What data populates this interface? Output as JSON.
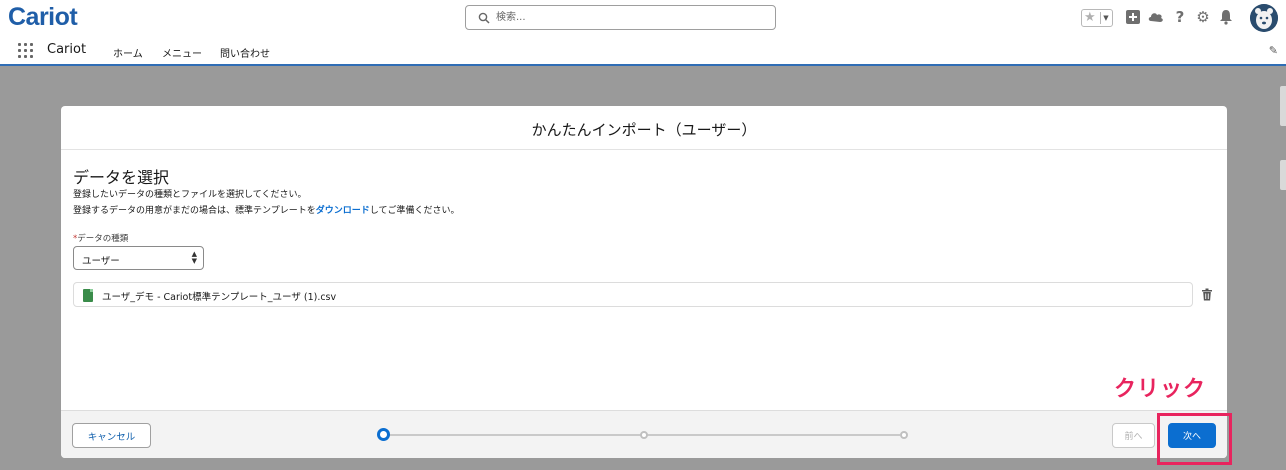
{
  "header": {
    "logo_text": "Cariot",
    "search_placeholder": "検索..."
  },
  "nav": {
    "app_name": "Cariot",
    "items": [
      {
        "label": "ホーム"
      },
      {
        "label": "メニュー"
      },
      {
        "label": "問い合わせ"
      }
    ]
  },
  "modal": {
    "title": "かんたんインポート（ユーザー）",
    "section_title": "データを選択",
    "description1": "登録したいデータの種類とファイルを選択してください。",
    "description2_prefix": "登録するデータの用意がまだの場合は、標準テンプレートを",
    "description2_link": "ダウンロード",
    "description2_suffix": "してご準備ください。",
    "field_label": "データの種類",
    "required_mark": "*",
    "select_value": "ユーザー",
    "file_name": "ユーザ_デモ - Cariot標準テンプレート_ユーザ (1).csv",
    "footer": {
      "cancel_label": "キャンセル",
      "prev_label": "前へ",
      "next_label": "次へ",
      "steps_total": 3,
      "current_step": 1
    }
  },
  "annotation": {
    "text": "クリック",
    "color": "#e8245e"
  },
  "colors": {
    "brand": "#1f5ea8",
    "primary": "#0b6ed0",
    "link": "#0b6ed0"
  }
}
